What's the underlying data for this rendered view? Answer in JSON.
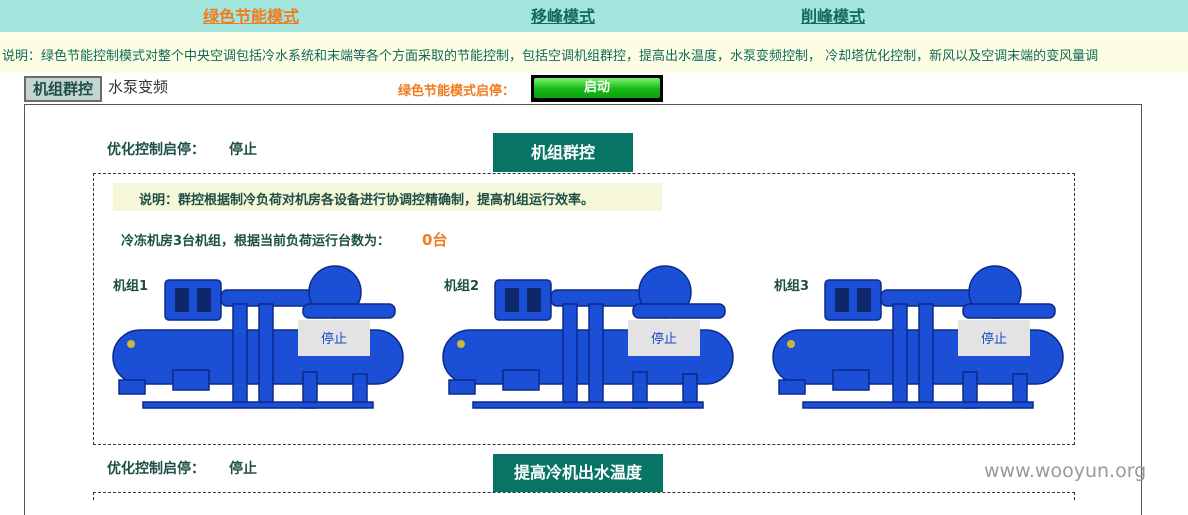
{
  "modes": {
    "green": "绿色节能模式",
    "shift": "移峰模式",
    "peak": "削峰模式"
  },
  "description": "说明：绿色节能控制模式对整个中央空调包括冷水系统和末端等各个方面采取的节能控制，包括空调机组群控，提高出水温度，水泵变频控制，  冷却塔优化控制，新风以及空调末端的变风量调",
  "tabs": {
    "unit_group": "机组群控",
    "pump_vfd": "水泵变频"
  },
  "green_mode_label": "绿色节能模式启停：",
  "start_button": "启动",
  "section1": {
    "opt_label": "优化控制启停：",
    "opt_value": "停止",
    "title": "机组群控",
    "note": "说明：群控根据制冷负荷对机房各设备进行协调控精确制，提高机组运行效率。",
    "count_label": "冷冻机房3台机组，根据当前负荷运行台数为：",
    "count_value": "0台",
    "units": [
      {
        "label": "机组1",
        "status": "停止"
      },
      {
        "label": "机组2",
        "status": "停止"
      },
      {
        "label": "机组3",
        "status": "停止"
      }
    ]
  },
  "section2": {
    "opt_label": "优化控制启停：",
    "opt_value": "停止",
    "title": "提高冷机出水温度"
  },
  "watermark": "www.wooyun.org",
  "colors": {
    "topbar": "#a2e6de",
    "accent_orange": "#f07c1e",
    "teal_dark": "#087465",
    "chiller_blue": "#1b4fd6"
  },
  "icons": [
    "chiller-unit-icon"
  ]
}
